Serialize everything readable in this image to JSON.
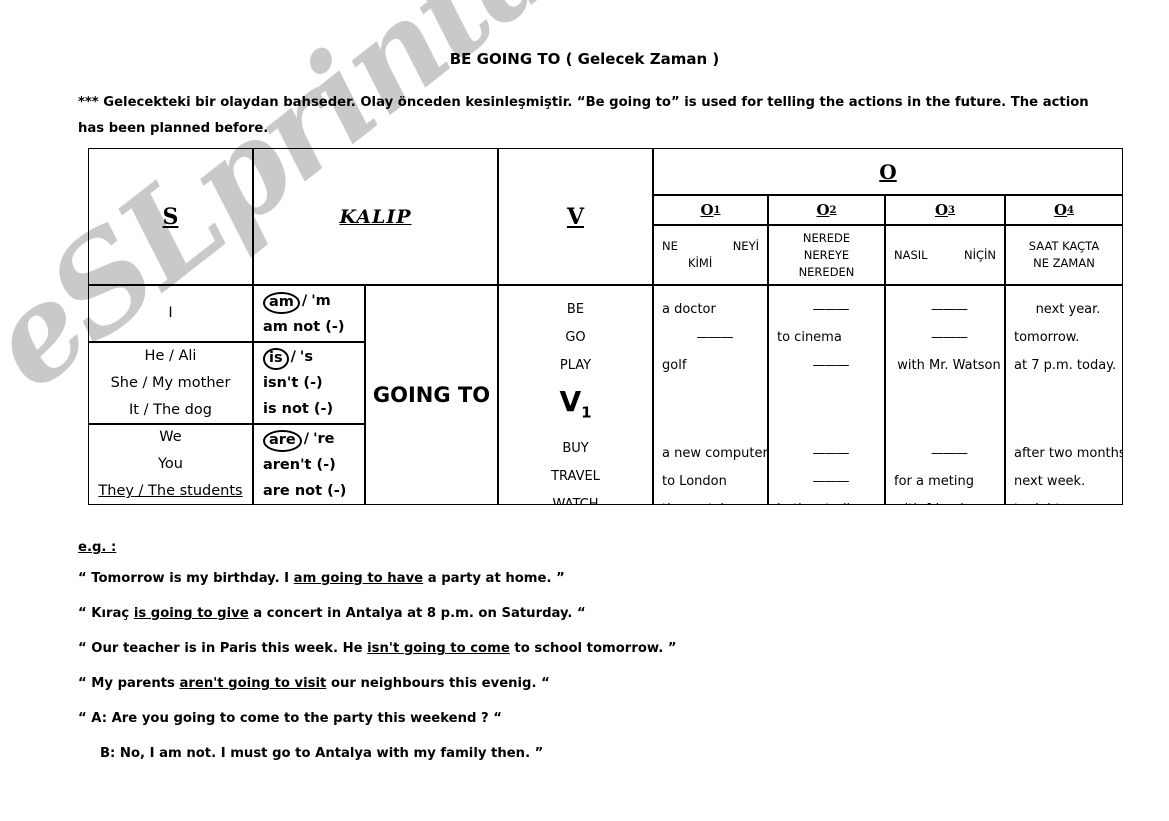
{
  "watermark": "eSLprintables.com",
  "title": "BE GOING TO ( Gelecek Zaman )",
  "intro": "*** Gelecekteki bir olaydan bahseder. Olay önceden kesinleşmiştir. “Be going to” is used for telling the actions in the future. The action has been planned before.",
  "table": {
    "headers": {
      "subject": "S",
      "pattern": "KALIP",
      "verb": "V",
      "object": "O",
      "o1": "O",
      "o1_sub": "1",
      "o2": "O",
      "o2_sub": "2",
      "o3": "O",
      "o3_sub": "3",
      "o4": "O",
      "o4_sub": "4"
    },
    "question_words": {
      "o1_line1_left": "NE",
      "o1_line1_right": "NEYİ",
      "o1_line2": "KİMİ",
      "o2_line1": "NEREDE",
      "o2_line2": "NEREYE",
      "o2_line3": "NEREDEN",
      "o3_line1_left": "NASIL",
      "o3_line1_right": "NİÇİN",
      "o4_line1": "SAAT KAÇTA",
      "o4_line2": "NE ZAMAN"
    },
    "subjects": [
      {
        "lines": [
          "I"
        ]
      },
      {
        "lines": [
          "He / Ali",
          "She / My mother",
          "It / The dog"
        ]
      },
      {
        "lines": [
          "We",
          "You",
          "They / The students"
        ]
      }
    ],
    "aux": [
      {
        "circled": "am",
        "short": "'m",
        "neg1": "am not (-)",
        "neg2": ""
      },
      {
        "circled": "is",
        "short": "'s",
        "neg1": "isn't (-)",
        "neg2": "is not (-)"
      },
      {
        "circled": "are",
        "short": "'re",
        "neg1": "aren't (-)",
        "neg2": "are not (-)"
      }
    ],
    "going_to": "GOING TO",
    "verbs_top": [
      "BE",
      "GO",
      "PLAY"
    ],
    "verb_middle": "V",
    "verb_middle_sub": "1",
    "verbs_bottom": [
      "BUY",
      "TRAVEL",
      "WATCH"
    ],
    "o1_values_top": [
      "a doctor",
      "———",
      "golf"
    ],
    "o1_values_bottom": [
      "a new computer",
      "to London",
      "the match"
    ],
    "o2_values_top": [
      "———",
      "to cinema",
      "———"
    ],
    "o2_values_bottom": [
      "———",
      "———",
      "in the stadium"
    ],
    "o3_values_top": [
      "———",
      "———",
      "with Mr. Watson"
    ],
    "o3_values_bottom": [
      "———",
      "for a meting",
      "with friends"
    ],
    "o4_values_top": [
      "next year.",
      "tomorrow.",
      "at 7 p.m. today."
    ],
    "o4_values_bottom": [
      "after two months.",
      "next week.",
      "tonight."
    ]
  },
  "examples": {
    "label": "e.g. :",
    "items": [
      {
        "pre": "“ Tomorrow is my birthday. I ",
        "underlined": "am going to have",
        "post": " a party at home. ”",
        "indent": false
      },
      {
        "pre": "“ Kıraç ",
        "underlined": "is going to give",
        "post": " a concert in Antalya at 8 p.m. on Saturday. “",
        "indent": false
      },
      {
        "pre": "“ Our teacher is in Paris this week. He ",
        "underlined": "isn't going to come",
        "post": " to school tomorrow. ”",
        "indent": false
      },
      {
        "pre": "“ My parents ",
        "underlined": "aren't going to visit",
        "post": " our neighbours this evenig. “",
        "indent": false
      },
      {
        "pre": "“ A: Are you going to come to the party this weekend ? “",
        "underlined": "",
        "post": "",
        "indent": false
      },
      {
        "pre": "B: No, I am not. I must go to Antalya with my family then. ”",
        "underlined": "",
        "post": "",
        "indent": true
      }
    ]
  }
}
